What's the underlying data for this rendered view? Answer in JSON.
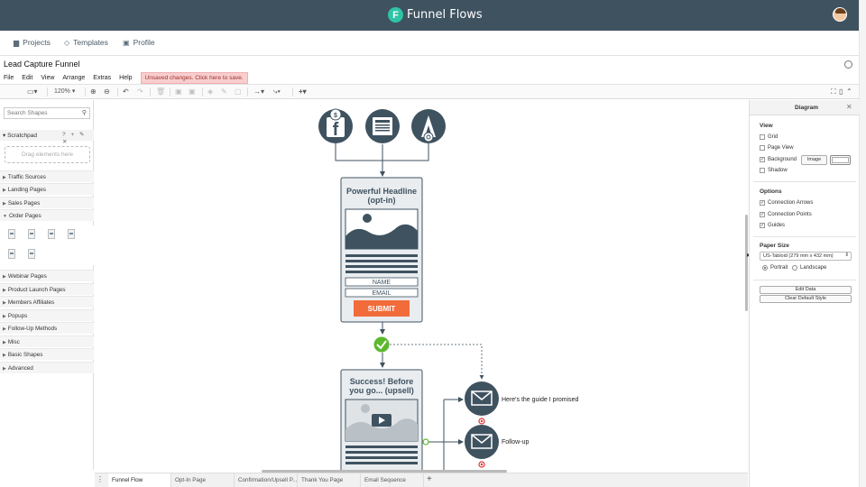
{
  "app": {
    "name": "Funnel Flows",
    "logo_glyph": "F"
  },
  "nav": {
    "projects": "Projects",
    "templates": "Templates",
    "profile": "Profile"
  },
  "document": {
    "title": "Lead Capture Funnel",
    "unsaved_notice": "Unsaved changes. Click here to save."
  },
  "menu": [
    "File",
    "Edit",
    "View",
    "Arrange",
    "Extras",
    "Help"
  ],
  "toolbar": {
    "zoom": "120%"
  },
  "left_panel": {
    "search_placeholder": "Search Shapes",
    "scratchpad": "Scratchpad",
    "scratchpad_tools": "? + ✎ ✕",
    "drag_hint": "Drag elements here",
    "categories_top": [
      "Traffic Sources",
      "Landing Pages",
      "Sales Pages",
      "Order Pages"
    ],
    "categories_bottom": [
      "Webinar Pages",
      "Product Launch Pages",
      "Members Affiliates",
      "Popups",
      "Follow-Up Methods",
      "Misc",
      "Basic Shapes",
      "Advanced"
    ]
  },
  "canvas": {
    "optin_title_1": "Powerful Headline",
    "optin_title_2": "(opt-in)",
    "name_field": "NAME",
    "email_field": "EMAIL",
    "submit": "SUBMIT",
    "success_title_1": "Success! Before",
    "success_title_2": "you go... (upsell)",
    "email1_label": "Here's the guide I promised",
    "email2_label": "Follow-up",
    "colors": {
      "node": "#3f5260",
      "submit": "#f26b3a",
      "check": "#5cb82e",
      "page_bg": "#e9edf0"
    }
  },
  "right_panel": {
    "title": "Diagram",
    "view_label": "View",
    "grid": "Grid",
    "page_view": "Page View",
    "background": "Background",
    "image_button": "Image",
    "shadow": "Shadow",
    "options_label": "Options",
    "connection_arrows": "Connection Arrows",
    "connection_points": "Connection Points",
    "guides": "Guides",
    "paper_size_label": "Paper Size",
    "paper_size_value": "US-Tabloid (279 mm x 432 mm)",
    "portrait": "Portrait",
    "landscape": "Landscape",
    "edit_data": "Edit Data",
    "clear_default_style": "Clear Default Style"
  },
  "tabs": [
    "Funnel Flow",
    "Opt-In Page",
    "Confirmation/Upsell P...",
    "Thank You Page",
    "Email Sequence"
  ]
}
